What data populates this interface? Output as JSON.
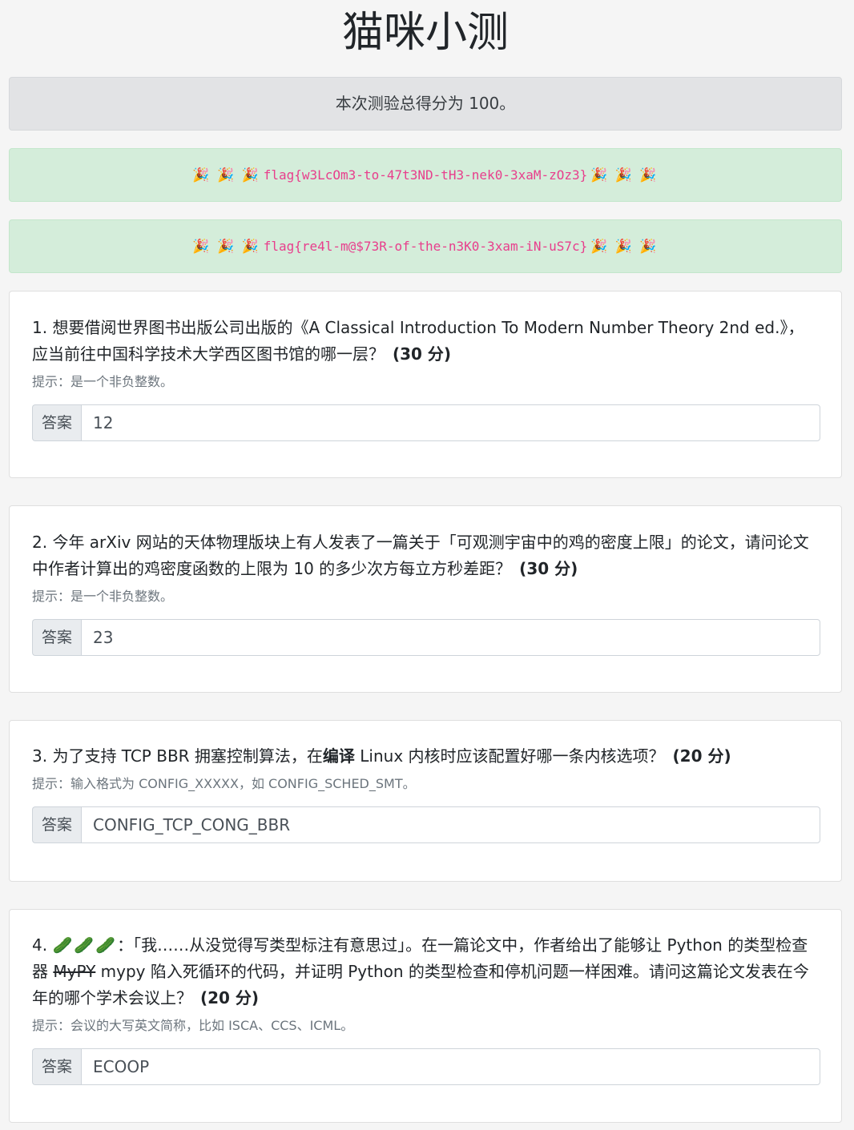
{
  "title": "猫咪小测",
  "score_text": "本次测验总得分为 100。",
  "flags": [
    {
      "prefix": "🎉 🎉 🎉",
      "flag": "flag{w3LcOm3-to-47t3ND-tH3-nek0-3xaM-zOz3}",
      "suffix": "🎉 🎉 🎉"
    },
    {
      "prefix": "🎉 🎉 🎉",
      "flag": "flag{re4l-m@$73R-of-the-n3K0-3xam-iN-uS7c}",
      "suffix": "🎉 🎉 🎉"
    }
  ],
  "answer_label": "答案",
  "questions": [
    {
      "text": "1. 想要借阅世界图书出版公司出版的《A Classical Introduction To Modern Number Theory 2nd ed.》，应当前往中国科学技术大学西区图书馆的哪一层？",
      "points": "(30 分)",
      "hint": "提示：是一个非负整数。",
      "answer": "12"
    },
    {
      "text": "2. 今年 arXiv 网站的天体物理版块上有人发表了一篇关于「可观测宇宙中的鸡的密度上限」的论文，请问论文中作者计算出的鸡密度函数的上限为 10 的多少次方每立方秒差距？",
      "points": "(30 分)",
      "hint": "提示：是一个非负整数。",
      "answer": "23"
    },
    {
      "text_before": "3. 为了支持 TCP BBR 拥塞控制算法，在",
      "text_bold": "编译",
      "text_after": " Linux 内核时应该配置好哪一条内核选项？",
      "points": "(20 分)",
      "hint": "提示：输入格式为 CONFIG_XXXXX，如 CONFIG_SCHED_SMT。",
      "answer": "CONFIG_TCP_CONG_BBR"
    },
    {
      "number": "4.",
      "emoji": "🥒🥒🥒",
      "text_before": "：「我……从没觉得写类型标注有意思过」。在一篇论文中，作者给出了能够让 Python 的类型检查器 ",
      "text_strike": "MyPY",
      "text_after": " mypy 陷入死循环的代码，并证明 Python 的类型检查和停机问题一样困难。请问这篇论文发表在今年的哪个学术会议上？",
      "points": "(20 分)",
      "hint": "提示：会议的大写英文简称，比如 ISCA、CCS、ICML。",
      "answer": "ECOOP"
    }
  ]
}
